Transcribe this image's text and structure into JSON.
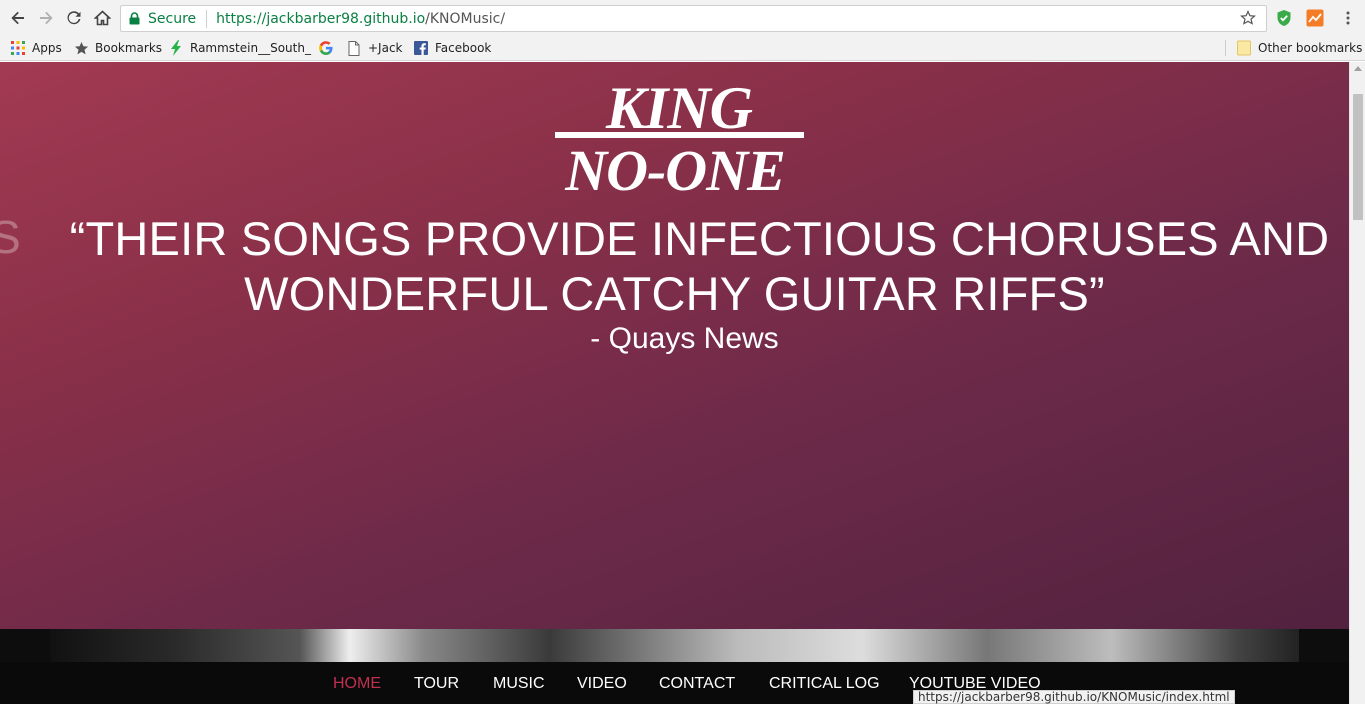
{
  "browser": {
    "secure_label": "Secure",
    "url_host": "https://jackbarber98.github.io",
    "url_path": "/KNOMusic/",
    "status_url": "https://jackbarber98.github.io/KNOMusic/index.html"
  },
  "bookmarks": {
    "items": [
      "Apps",
      "Bookmarks",
      "Rammstein__South_",
      "",
      "+Jack",
      "Facebook"
    ],
    "other": "Other bookmarks"
  },
  "hero": {
    "logo_line1": "KING",
    "logo_line2": "NO-ONE",
    "side_letter": "S",
    "quote_line1": "“THEIR SONGS PROVIDE INFECTIOUS CHORUSES AND",
    "quote_line2": "WONDERFUL CATCHY GUITAR RIFFS”",
    "attribution": "- Quays News"
  },
  "nav": {
    "items": [
      "HOME",
      "TOUR",
      "MUSIC",
      "VIDEO",
      "CONTACT",
      "CRITICAL LOG",
      "YOUTUBE VIDEO"
    ],
    "active": "HOME"
  },
  "colors": {
    "hero_start": "#a23a52",
    "hero_end": "#51223f",
    "nav_active": "#c0304f",
    "secure_green": "#0b8043"
  }
}
